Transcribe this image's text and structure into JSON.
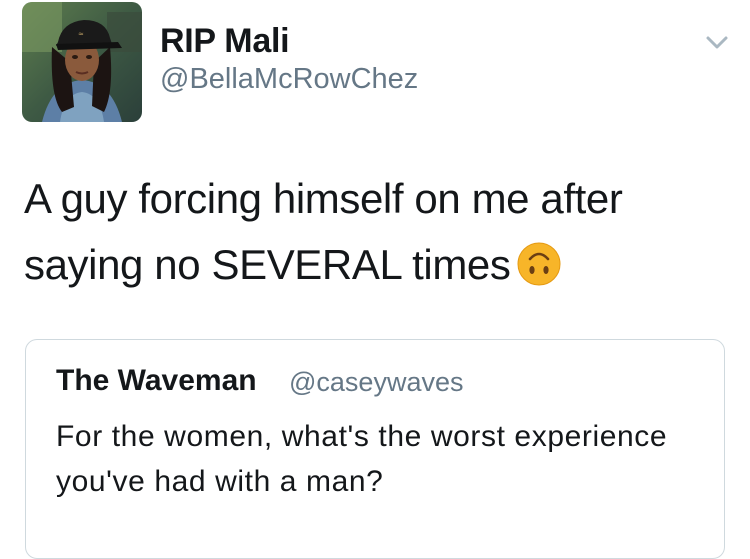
{
  "tweet": {
    "author": {
      "display_name": "RIP Mali",
      "handle": "@BellaMcRowChez",
      "avatar_icon": "profile-photo"
    },
    "menu_icon": "chevron-down-icon",
    "text": "A guy forcing himself on me after saying no SEVERAL times",
    "emoji": "upside-down-face-emoji"
  },
  "quoted_tweet": {
    "display_name": "The Waveman",
    "handle": "@caseywaves",
    "text": "For the women, what's the worst experience you've had with a man?"
  },
  "colors": {
    "text_primary": "#14171a",
    "text_secondary": "#657786",
    "border": "#cfd9de",
    "emoji_yellow": "#f7b529"
  }
}
